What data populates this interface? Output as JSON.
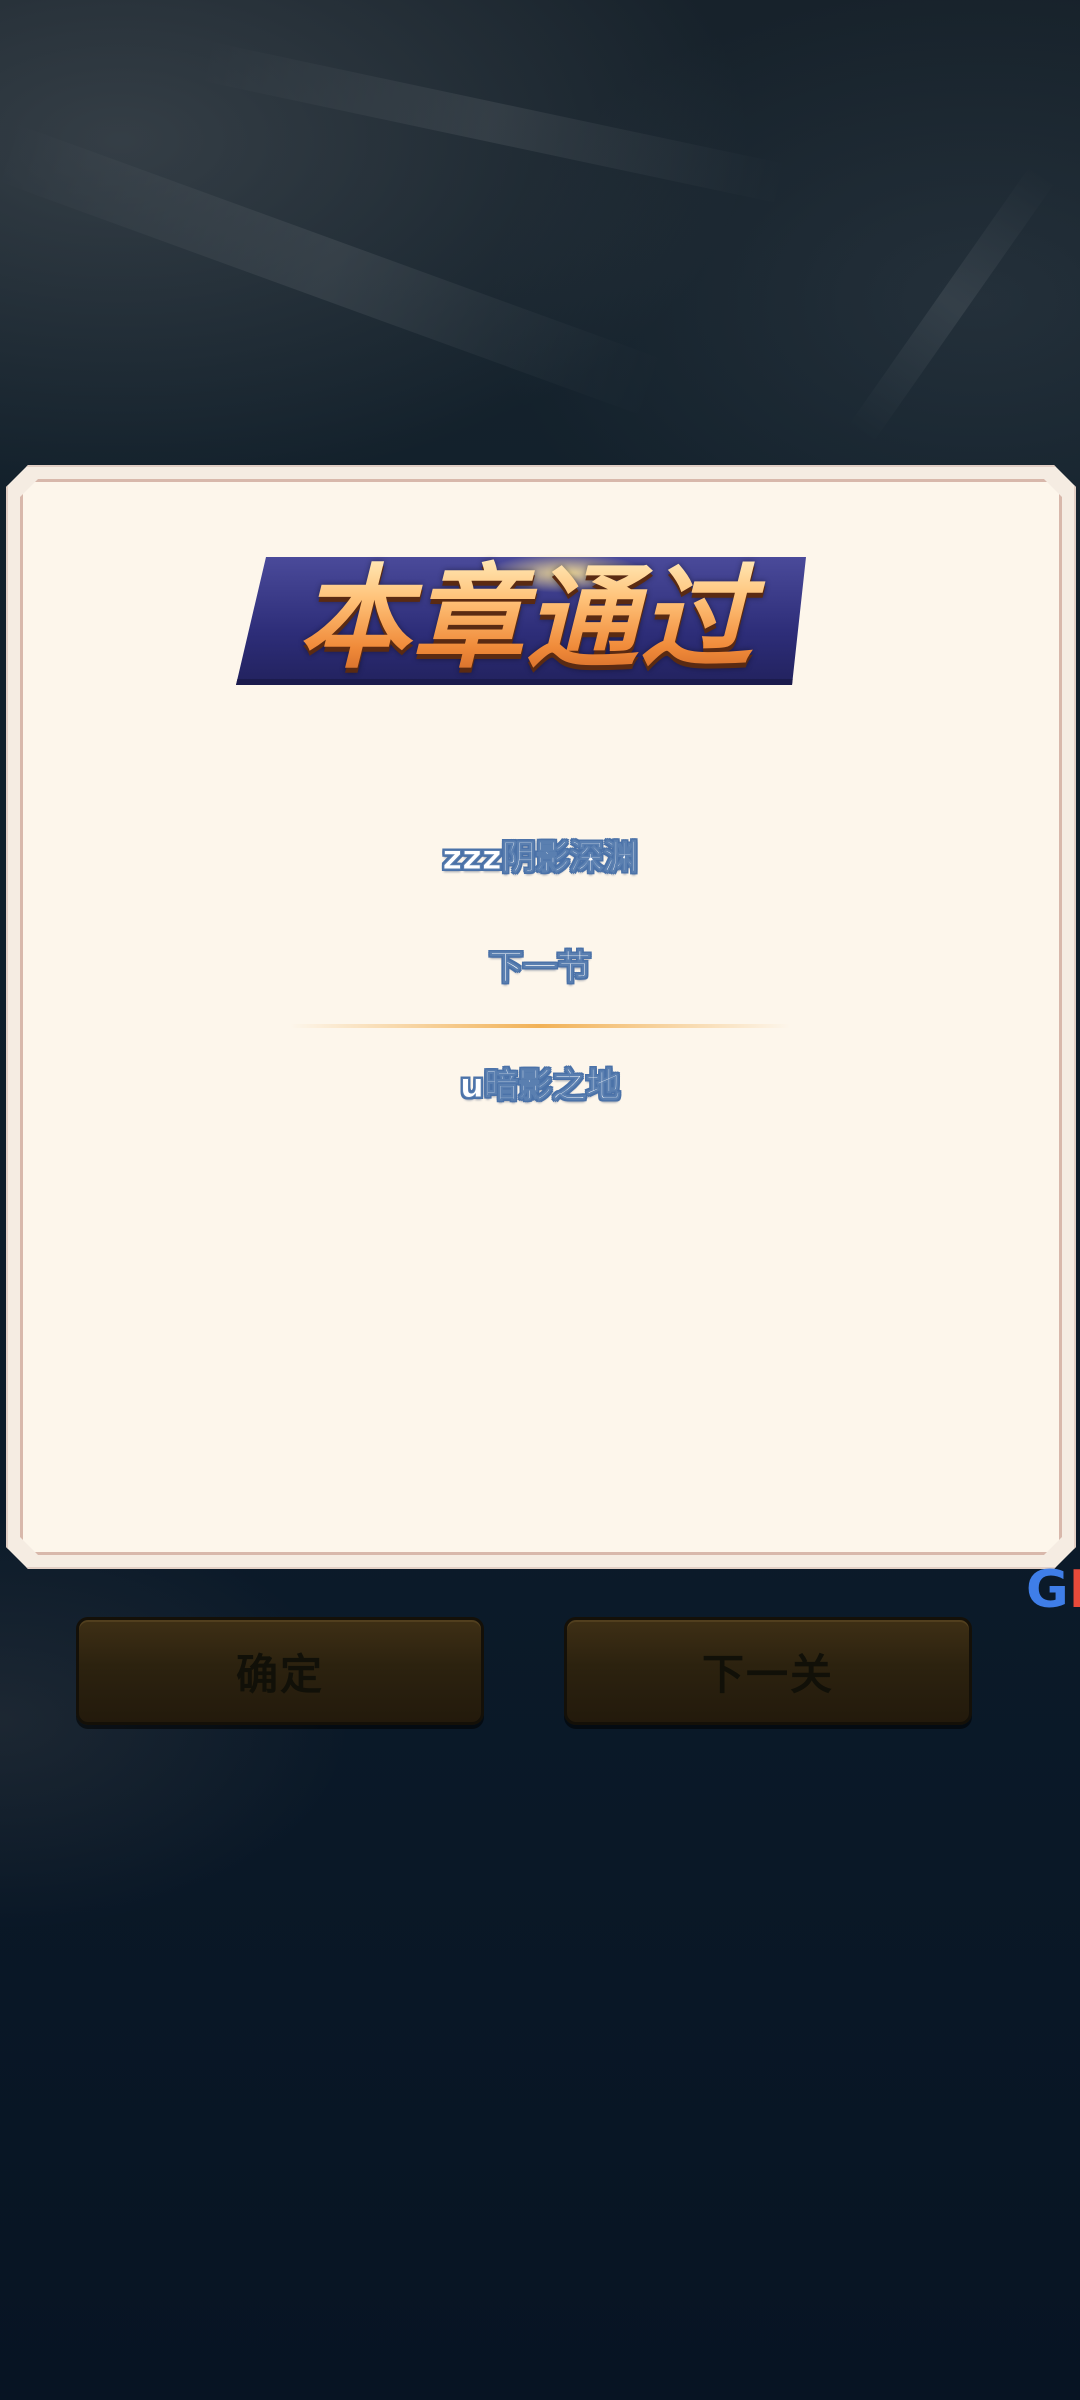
{
  "dialog": {
    "title": "本章通过",
    "current_level": "zzz阴影深渊",
    "next_label": "下一节",
    "next_level": "u暗影之地"
  },
  "buttons": {
    "confirm_label": "确定",
    "next_stage_label": "下一关"
  },
  "edge_logo": {
    "visible_text_g": "G",
    "visible_text_k": "K"
  }
}
